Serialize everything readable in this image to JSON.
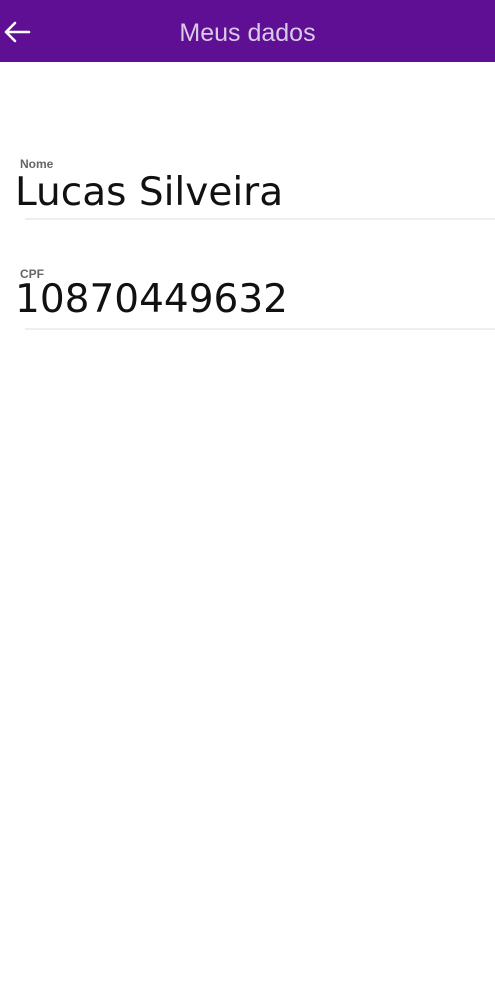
{
  "header": {
    "title": "Meus dados",
    "back_icon": "arrow-left-icon",
    "background_color": "#5e0f93",
    "title_color": "#d9cbe8"
  },
  "fields": [
    {
      "label": "Nome",
      "value": "Lucas Silveira"
    },
    {
      "label": "CPF",
      "value": "10870449632"
    }
  ]
}
